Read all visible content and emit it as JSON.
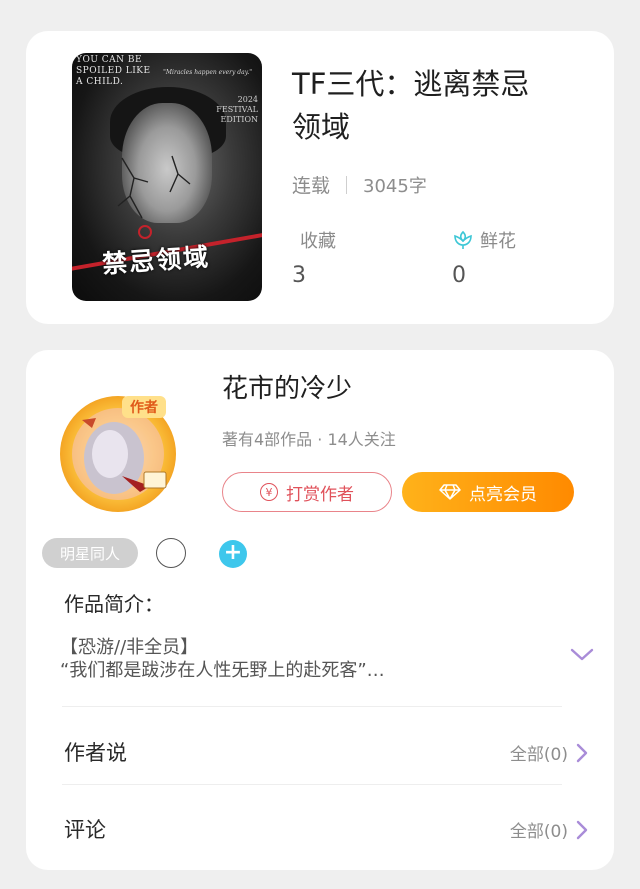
{
  "book": {
    "title_line1": "TF三代：逃离禁忌",
    "title_line2": "领域",
    "status": "连载",
    "word_count": "3045字",
    "favorites_label": "收藏",
    "favorites_value": "3",
    "flowers_label": "鲜花",
    "flowers_value": "0",
    "cover": {
      "top_text_1": "YOU CAN BE",
      "top_text_2": "SPOILED LIKE",
      "top_text_3": "A CHILD.",
      "quote": "\"Miracles happen every day.\"",
      "side_1": "2024",
      "side_2": "FESTIVAL",
      "side_3": "EDITION",
      "title": "禁忌领域"
    }
  },
  "author": {
    "name": "花市的冷少",
    "stats": "著有4部作品 · 14人关注",
    "badge": "作者",
    "reward_button": "打赏作者",
    "reward_icon": "¥",
    "vip_button": "点亮会员"
  },
  "tags": {
    "chip": "明星同人",
    "add": "+"
  },
  "intro": {
    "title": "作品简介：",
    "line1": "【恐游//非全员】",
    "line2": "“我们都是跋涉在人性旡野上的赴死客”…"
  },
  "rows": {
    "author_say": "作者说",
    "author_say_count": "全部(0)",
    "comments": "评论",
    "comments_count": "全部(0)"
  },
  "colors": {
    "accent_purple": "#a98cd8",
    "flower_icon": "#3ec7d6",
    "reward_red": "#e0525b",
    "vip_orange": "#ff9500",
    "tag_blue": "#3ec7ec"
  }
}
